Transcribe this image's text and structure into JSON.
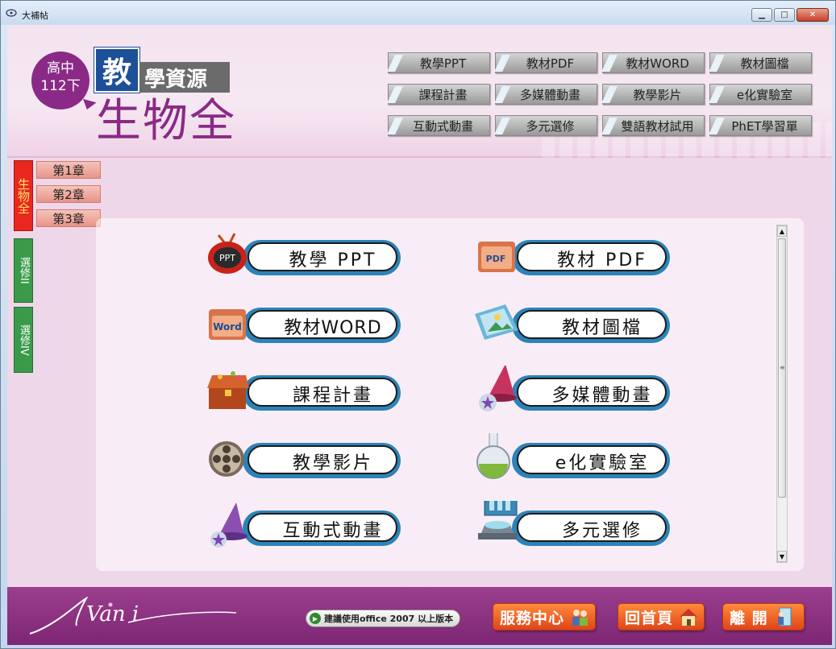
{
  "window": {
    "title": "大補帖",
    "minimize": "▁",
    "maximize": "□",
    "close": "✕"
  },
  "brand": {
    "grade_line1": "高中",
    "grade_line2": "112下",
    "jiao": "教",
    "ziyuan": "學資源",
    "subject": "生物全"
  },
  "top_nav": [
    "教學PPT",
    "教材PDF",
    "教材WORD",
    "教材圖檔",
    "課程計畫",
    "多媒體動畫",
    "教學影片",
    "e化實驗室",
    "互動式動畫",
    "多元選修",
    "雙語教材試用",
    "PhET學習單"
  ],
  "side_tabs": {
    "active": "生物全",
    "tab2": "選修II",
    "tab3": "選修IV"
  },
  "chapters": [
    "第1章",
    "第2章",
    "第3章"
  ],
  "items": [
    {
      "label": "教學 PPT",
      "icon": "ppt-tv-icon"
    },
    {
      "label": "教材 PDF",
      "icon": "pdf-folder-icon"
    },
    {
      "label": "教材WORD",
      "icon": "word-folder-icon"
    },
    {
      "label": "教材圖檔",
      "icon": "image-folder-icon"
    },
    {
      "label": "課程計畫",
      "icon": "treasure-chest-icon"
    },
    {
      "label": "多媒體動畫",
      "icon": "wizard-hat-icon"
    },
    {
      "label": "教學影片",
      "icon": "film-reel-icon"
    },
    {
      "label": "e化實驗室",
      "icon": "flask-icon"
    },
    {
      "label": "互動式動畫",
      "icon": "wizard-hat-icon"
    },
    {
      "label": "多元選修",
      "icon": "display-stand-icon"
    }
  ],
  "footer": {
    "logo_text": "Van i",
    "office_note": "建議使用office 2007 以上版本",
    "service_center": "服務中心",
    "home": "回首頁",
    "exit": "離 開"
  },
  "colors": {
    "brand_purple": "#8a2a86",
    "accent_blue": "#2c83b8",
    "footer_orange": "#e0451a"
  }
}
